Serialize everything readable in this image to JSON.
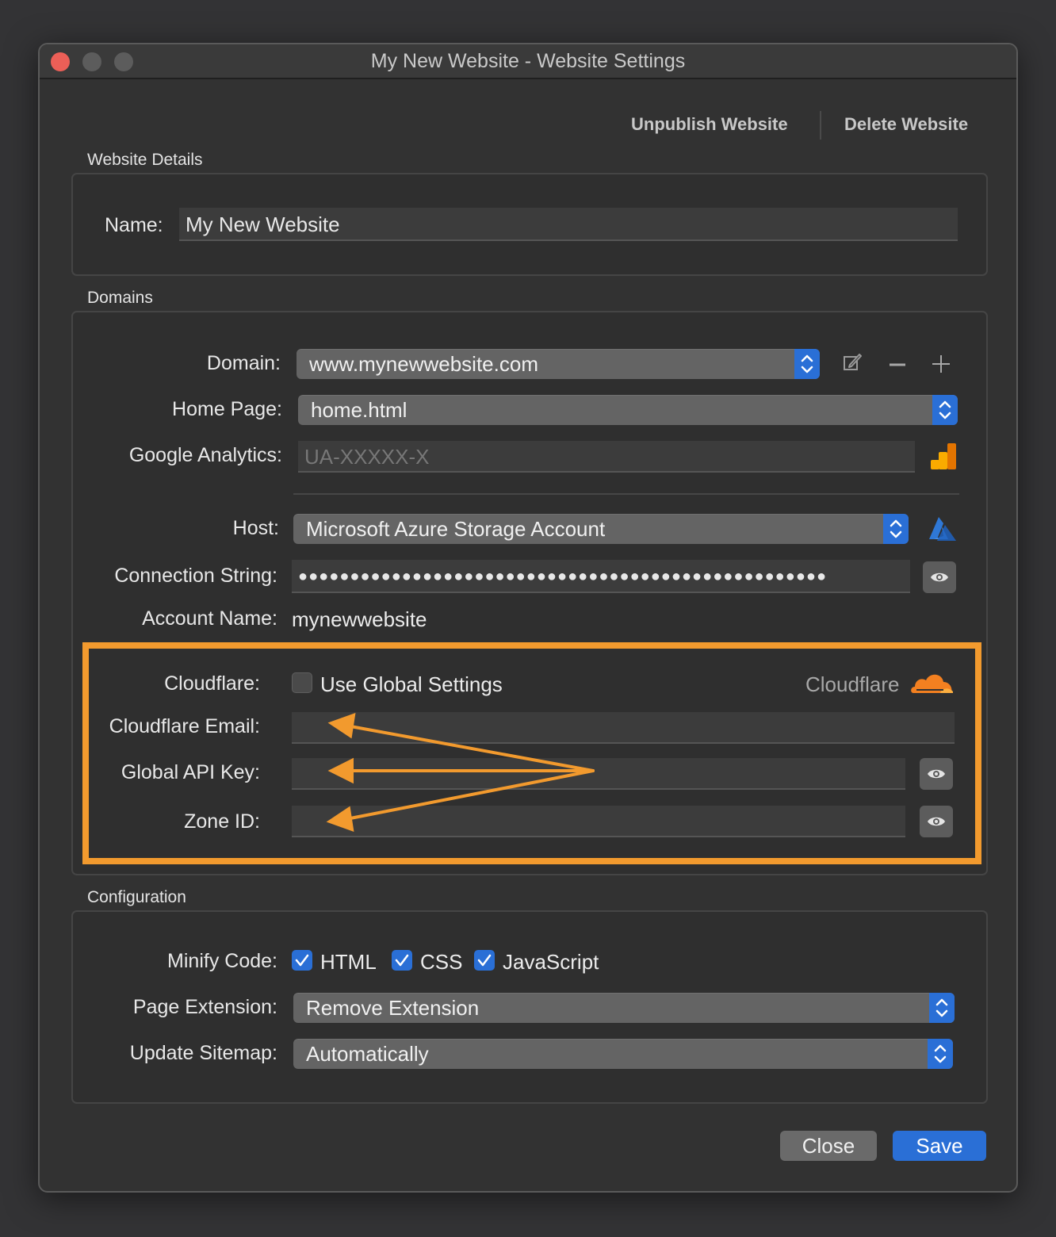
{
  "window": {
    "title": "My New Website - Website Settings"
  },
  "toolbar": {
    "unpublish_label": "Unpublish Website",
    "delete_label": "Delete Website"
  },
  "details": {
    "section_label": "Website Details",
    "name_label": "Name:",
    "name_value": "My New Website"
  },
  "domains": {
    "section_label": "Domains",
    "domain_label": "Domain:",
    "domain_value": "www.mynewwebsite.com",
    "home_label": "Home Page:",
    "home_value": "home.html",
    "ga_label": "Google Analytics:",
    "ga_placeholder": "UA-XXXXX-X",
    "host_label": "Host:",
    "host_value": "Microsoft Azure Storage Account",
    "conn_label": "Connection String:",
    "conn_value": "●●●●●●●●●●●●●●●●●●●●●●●●●●●●●●●●●●●●●●●●●●●●●●●●●●●",
    "account_label": "Account Name:",
    "account_value": "mynewwebsite",
    "cloudflare_label": "Cloudflare:",
    "cloudflare_checkbox_label": "Use Global Settings",
    "cloudflare_checked": false,
    "cloudflare_brand": "Cloudflare",
    "cf_email_label": "Cloudflare Email:",
    "cf_email_value": "",
    "cf_apikey_label": "Global API Key:",
    "cf_apikey_value": "",
    "cf_zone_label": "Zone ID:",
    "cf_zone_value": ""
  },
  "configuration": {
    "section_label": "Configuration",
    "minify_label": "Minify Code:",
    "minify_options": [
      {
        "label": "HTML",
        "checked": true
      },
      {
        "label": "CSS",
        "checked": true
      },
      {
        "label": "JavaScript",
        "checked": true
      }
    ],
    "extension_label": "Page Extension:",
    "extension_value": "Remove Extension",
    "sitemap_label": "Update Sitemap:",
    "sitemap_value": "Automatically"
  },
  "footer": {
    "close_label": "Close",
    "save_label": "Save"
  },
  "colors": {
    "accent": "#2a6fd6",
    "highlight": "#f29a2e",
    "cloudflare": "#f38020",
    "analytics": "#f9ab00",
    "azure": "#2f78d6"
  },
  "icons": [
    "edit-icon",
    "minus-icon",
    "plus-icon",
    "google-analytics-icon",
    "azure-icon",
    "eye-icon",
    "cloudflare-cloud-icon",
    "checkmark-icon",
    "stepper-arrows-icon"
  ]
}
